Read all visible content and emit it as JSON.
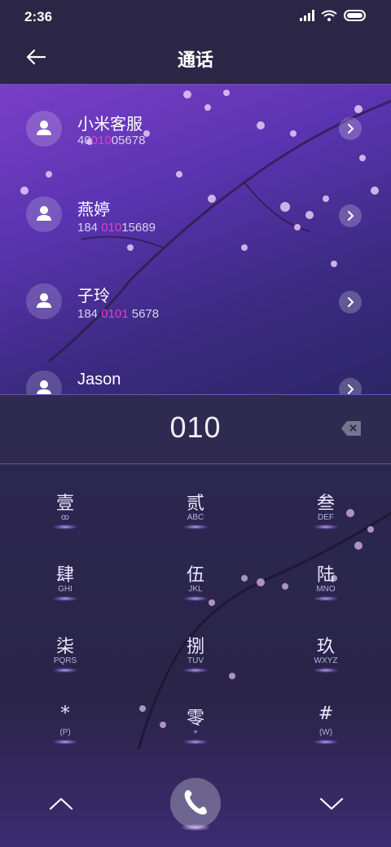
{
  "status": {
    "time": "2:36",
    "icons": [
      "signal-icon",
      "wifi-icon",
      "battery-icon"
    ]
  },
  "header": {
    "title": "通话",
    "back_icon": "arrow-left-icon"
  },
  "contacts": [
    {
      "name": "小米客服",
      "number_pre": "40",
      "number_hl": "010",
      "number_post": "05678"
    },
    {
      "name": "燕婷",
      "number_pre": "184 ",
      "number_hl": "010",
      "number_post": "15689"
    },
    {
      "name": "子玲",
      "number_pre": "184 ",
      "number_hl": "0101",
      "number_post": " 5678"
    },
    {
      "name": "Jason",
      "number_pre": "",
      "number_hl": "",
      "number_post": ""
    }
  ],
  "dial": {
    "input_value": "010",
    "delete_icon": "backspace-icon"
  },
  "keypad": [
    {
      "main": "壹",
      "sub": "ꝏ"
    },
    {
      "main": "贰",
      "sub": "ABC"
    },
    {
      "main": "叁",
      "sub": "DEF"
    },
    {
      "main": "肆",
      "sub": "GHI"
    },
    {
      "main": "伍",
      "sub": "JKL"
    },
    {
      "main": "陆",
      "sub": "MNO"
    },
    {
      "main": "柒",
      "sub": "PQRS"
    },
    {
      "main": "捌",
      "sub": "TUV"
    },
    {
      "main": "玖",
      "sub": "WXYZ"
    },
    {
      "main": "*",
      "sub": "(P)"
    },
    {
      "main": "零",
      "sub": "+"
    },
    {
      "main": "#",
      "sub": "(W)"
    }
  ],
  "bottom": {
    "up_icon": "chevron-up-icon",
    "call_icon": "phone-icon",
    "down_icon": "chevron-down-icon"
  },
  "colors": {
    "accent": "#e040c8",
    "header_bg": "#2c2646",
    "list_bg": "#5a34b0",
    "keypad_bg": "#2a2448"
  }
}
